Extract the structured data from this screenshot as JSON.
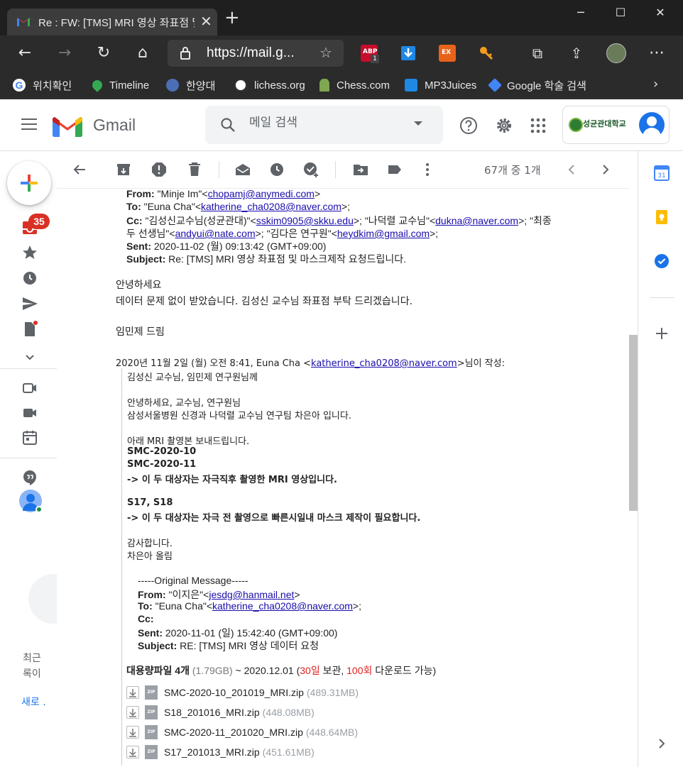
{
  "browser": {
    "tab_title": "Re : FW: [TMS] MRI 영상 좌표점 및",
    "url": "https://mail.g...",
    "bookmarks": [
      {
        "label": "위치확인",
        "icon": "google-icon",
        "color": "#4285f4"
      },
      {
        "label": "Timeline",
        "icon": "maps-pin-icon",
        "color": "#34a853"
      },
      {
        "label": "한양대",
        "icon": "hanyang-icon",
        "color": "#4a6fb5"
      },
      {
        "label": "lichess.org",
        "icon": "lichess-icon",
        "color": "#ffffff"
      },
      {
        "label": "Chess.com",
        "icon": "pawn-icon",
        "color": "#7fa650"
      },
      {
        "label": "MP3Juices",
        "icon": "download-icon",
        "color": "#1e88e5"
      },
      {
        "label": "Google 학술 검색",
        "icon": "scholar-icon",
        "color": "#4285f4"
      }
    ],
    "extensions": [
      {
        "name": "abp-icon",
        "badge": "1",
        "color": "#c70d2c"
      },
      {
        "name": "download-ext-icon",
        "color": "#1e88e5"
      },
      {
        "name": "ex-icon",
        "label": "EX",
        "color": "#e8631a"
      },
      {
        "name": "key-icon",
        "color": "#f29b1d"
      }
    ]
  },
  "gmail": {
    "logo_text": "Gmail",
    "search_placeholder": "메일 검색",
    "org_name": "성균관대학교",
    "unread_badge": "35",
    "pager": "67개 중 1개",
    "rail_text_1": "최근",
    "rail_text_2": "록이",
    "rail_text_3": "새로 ."
  },
  "message": {
    "from_label": "From:",
    "from_name": " \"Minje Im\"<",
    "from_email": "chopamj@anymedi.com",
    "from_end": ">",
    "to_label": "To:",
    "to_name": " \"Euna Cha\"<",
    "to_email": "katherine_cha0208@naver.com",
    "to_end": ">;",
    "cc_label": "Cc:",
    "cc_1": " \"김성신교수님(성균관대)\"<",
    "cc_1_email": "sskim0905@skku.edu",
    "cc_2": ">; \"나덕렬 교수님\"<",
    "cc_2_email": "dukna@naver.com",
    "cc_3": ">; \"최종",
    "cc_4": "두 선생님\"<",
    "cc_4_email": "andyui@nate.com",
    "cc_5": ">; \"김다은 연구원\"<",
    "cc_5_email": "heydkim@gmail.com",
    "cc_6": ">;",
    "sent_label": "Sent:",
    "sent_value": " 2020-11-02 (월) 09:13:42 (GMT+09:00)",
    "subject_label": "Subject:",
    "subject_value": " Re: [TMS] MRI 영상 좌표점 및 마스크제작 요청드립니다.",
    "greeting": "안녕하세요",
    "body_1": "데이터 문제 없이 받았습니다. 김성신 교수님 좌표점 부탁 드리겠습니다.",
    "signature": "임민제 드림",
    "quote_header_pre": "2020년 11월 2일 (월) 오전 8:41, Euna Cha <",
    "quote_header_email": "katherine_cha0208@naver.com",
    "quote_header_post": ">님이 작성:",
    "q_1": "김성신 교수님, 임민제 연구원님께",
    "q_2": "안녕하세요, 교수님, 연구원님",
    "q_3": "삼성서울병원 신경과 나덕렬 교수님 연구팀 차은아 입니다.",
    "q_4": "아래 MRI 촬영본 보내드립니다.",
    "q_5": "SMC-2020-10",
    "q_6": "SMC-2020-11",
    "q_7": "-> 이 두 대상자는 자극직후 촬영한 MRI 영상입니다.",
    "q_8": "S17, S18",
    "q_9": "-> 이 두 대상자는 자극 전 촬영으로 빠른시일내 마스크 제작이 필요합니다.",
    "q_10": "감사합니다.",
    "q_11": "차은아 올림",
    "orig_title": "-----Original Message-----",
    "orig_from_label": "From:",
    "orig_from_name": " \"이지은\"<",
    "orig_from_email": "jesdg@hanmail.net",
    "orig_from_end": ">",
    "orig_to_label": "To:",
    "orig_to_name": " \"Euna Cha\"<",
    "orig_to_email": "katherine_cha0208@naver.com",
    "orig_to_end": ">;",
    "orig_cc_label": "Cc:",
    "orig_sent_label": "Sent:",
    "orig_sent_value": " 2020-11-01 (일) 15:42:40 (GMT+09:00)",
    "orig_subject_label": "Subject:",
    "orig_subject_value": " RE: [TMS] MRI 영상 데이터 요청"
  },
  "attachments": {
    "header_bold": "대용량파일 4개",
    "header_size": " (1.79GB)",
    "header_mid": " ~ 2020.12.01 (",
    "header_days": "30일",
    "header_keep": " 보관, ",
    "header_count": "100회",
    "header_end": " 다운로드 가능)",
    "files": [
      {
        "name": "SMC-2020-10_201019_MRI.zip",
        "size": "(489.31MB)"
      },
      {
        "name": "S18_201016_MRI.zip",
        "size": "(448.08MB)"
      },
      {
        "name": "SMC-2020-11_201020_MRI.zip",
        "size": "(448.64MB)"
      },
      {
        "name": "S17_201013_MRI.zip",
        "size": "(451.61MB)"
      }
    ]
  }
}
